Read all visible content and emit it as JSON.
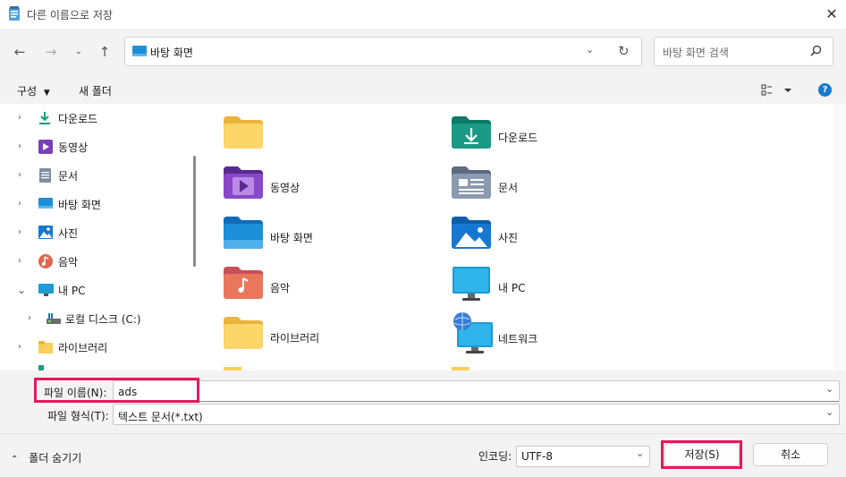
{
  "window": {
    "title": "다른 이름으로 저장",
    "icon": "notepad-icon",
    "close_icon": "close-icon"
  },
  "nav": {
    "back_icon": "back-arrow-icon",
    "forward_icon": "forward-arrow-icon",
    "recent_icon": "chevron-down-icon",
    "up_icon": "up-arrow-icon",
    "address": {
      "icon": "desktop-icon",
      "path": "바탕 화면"
    },
    "refresh_icon": "refresh-icon",
    "search_placeholder": "바탕 화면 검색"
  },
  "commandbar": {
    "organize": "구성",
    "new_folder": "새 폴더",
    "view_icon": "view-options-icon",
    "help_icon": "help-icon"
  },
  "sidebar": {
    "items": [
      {
        "label": "다운로드",
        "icon": "download-icon"
      },
      {
        "label": "동영상",
        "icon": "video-icon"
      },
      {
        "label": "문서",
        "icon": "document-icon"
      },
      {
        "label": "바탕 화면",
        "icon": "desktop-icon"
      },
      {
        "label": "사진",
        "icon": "pictures-icon"
      },
      {
        "label": "음악",
        "icon": "music-icon"
      },
      {
        "label": "내 PC",
        "icon": "pc-icon",
        "expanded": true
      },
      {
        "label": "로컬 디스크 (C:)",
        "icon": "drive-icon"
      },
      {
        "label": "라이브러리",
        "icon": "library-icon"
      }
    ]
  },
  "content": {
    "items": [
      {
        "label": "",
        "icon": "folder-icon"
      },
      {
        "label": "다운로드",
        "icon": "download-folder-icon"
      },
      {
        "label": "동영상",
        "icon": "video-folder-icon"
      },
      {
        "label": "문서",
        "icon": "document-folder-icon"
      },
      {
        "label": "바탕 화면",
        "icon": "desktop-folder-icon"
      },
      {
        "label": "사진",
        "icon": "pictures-folder-icon"
      },
      {
        "label": "음악",
        "icon": "music-folder-icon"
      },
      {
        "label": "내 PC",
        "icon": "monitor-icon"
      },
      {
        "label": "라이브러리",
        "icon": "library-folder-icon"
      },
      {
        "label": "네트워크",
        "icon": "network-icon"
      }
    ]
  },
  "form": {
    "filename_label": "파일 이름(N):",
    "filename_value": "ads",
    "filetype_label": "파일 형식(T):",
    "filetype_value": "텍스트 문서(*.txt)",
    "hide_folders": "폴더 숨기기",
    "encoding_label": "인코딩:",
    "encoding_value": "UTF-8",
    "save": "저장(S)",
    "cancel": "취소"
  },
  "colors": {
    "highlight": "#e8175d",
    "folder": "#f8cf5a",
    "teal": "#1a9a84",
    "purple": "#7b3fb5",
    "blue": "#1778d2"
  }
}
